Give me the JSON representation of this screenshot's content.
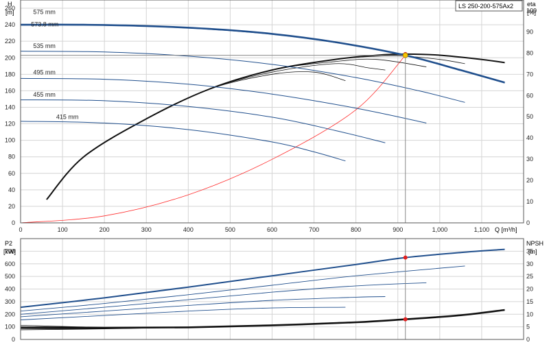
{
  "colors": {
    "frame": "#555555",
    "grid": "#d4d4d4",
    "blue_curve": "#1f4e8c",
    "black_curve": "#111111",
    "red_curve": "#ff2a2a",
    "marker_red": "#e02020",
    "marker_yellow": "#f5c400",
    "operating_line": "#888888"
  },
  "chart_data": [
    {
      "type": "line",
      "title": "LS 250-200-575Ax2",
      "xlabel": "Q [m³/h]",
      "xlim": [
        0,
        1200
      ],
      "x_ticks": [
        0,
        100,
        200,
        300,
        400,
        500,
        600,
        700,
        800,
        900,
        1000,
        1100
      ],
      "x_tick_labels": [
        "0",
        "100",
        "200",
        "300",
        "400",
        "500",
        "600",
        "700",
        "800",
        "900",
        "1,000",
        "1,100"
      ],
      "y_left": {
        "label_line1": "H",
        "label_line2": "[m]",
        "lim": [
          0,
          270
        ],
        "ticks": [
          0,
          20,
          40,
          60,
          80,
          100,
          120,
          140,
          160,
          180,
          200,
          220,
          240,
          260
        ]
      },
      "y_right": {
        "label_line1": "eta",
        "label_line2": "[%]",
        "lim": [
          0,
          105
        ],
        "ticks": [
          0,
          10,
          20,
          30,
          40,
          50,
          60,
          70,
          80,
          90,
          100
        ]
      },
      "head_curves": [
        {
          "label": "575 mm",
          "label_pos_x": 30,
          "label_pos_y": 253,
          "weight": "bold",
          "x": [
            0,
            150,
            300,
            450,
            600,
            750,
            918,
            1050,
            1155
          ],
          "y": [
            240,
            240,
            238.5,
            235,
            229,
            219,
            203,
            185,
            170
          ]
        },
        {
          "label": "573.8 mm",
          "label_pos_x": 25,
          "label_pos_y": 238,
          "weight": "thin",
          "x": [
            0,
            150,
            300,
            450,
            600,
            750,
            918,
            1050,
            1155
          ],
          "y": [
            239.5,
            239.5,
            238,
            234.5,
            228.5,
            218.5,
            202.5,
            184.5,
            169.5
          ]
        },
        {
          "label": "535 mm",
          "label_pos_x": 30,
          "label_pos_y": 212,
          "weight": "thin",
          "x": [
            0,
            200,
            400,
            600,
            800,
            950,
            1060
          ],
          "y": [
            208,
            207,
            202,
            192,
            176,
            160,
            146
          ]
        },
        {
          "label": "495 mm",
          "label_pos_x": 30,
          "label_pos_y": 180,
          "weight": "thin",
          "x": [
            0,
            200,
            400,
            600,
            800,
            968
          ],
          "y": [
            175,
            174,
            168,
            156,
            139,
            121
          ]
        },
        {
          "label": "455 mm",
          "label_pos_x": 30,
          "label_pos_y": 153,
          "weight": "thin",
          "x": [
            0,
            200,
            400,
            600,
            750,
            870
          ],
          "y": [
            149,
            148,
            141,
            128,
            112,
            97
          ]
        },
        {
          "label": "415 mm",
          "label_pos_x": 85,
          "label_pos_y": 126,
          "weight": "thin",
          "x": [
            0,
            200,
            400,
            600,
            700,
            775
          ],
          "y": [
            123,
            121,
            113,
            98,
            86,
            75
          ]
        }
      ],
      "efficiency_curves": [
        {
          "weight": "bold",
          "x": [
            62,
            150,
            300,
            450,
            600,
            750,
            850,
            918,
            1000,
            1100,
            1155
          ],
          "y": [
            11,
            31,
            49,
            63,
            72,
            77,
            79,
            79.5,
            79,
            77,
            75.5
          ]
        },
        {
          "weight": "thin",
          "x": [
            62,
            150,
            300,
            450,
            600,
            750,
            850,
            918,
            1000,
            1060
          ],
          "y": [
            11,
            31,
            49,
            63,
            72,
            77,
            78.5,
            78.5,
            77,
            75
          ]
        },
        {
          "weight": "thin",
          "x": [
            62,
            150,
            300,
            450,
            600,
            750,
            850,
            968
          ],
          "y": [
            11,
            31,
            49,
            63,
            72,
            76,
            77,
            73.5
          ]
        },
        {
          "weight": "thin",
          "x": [
            62,
            150,
            300,
            450,
            600,
            750,
            830,
            870
          ],
          "y": [
            11,
            31,
            49,
            63,
            71,
            75,
            73,
            72
          ]
        },
        {
          "weight": "thin",
          "x": [
            62,
            150,
            300,
            450,
            600,
            700,
            775
          ],
          "y": [
            11,
            31,
            49,
            63,
            70,
            71,
            67
          ]
        }
      ],
      "system_curve": {
        "x": [
          0,
          200,
          400,
          600,
          800,
          918
        ],
        "y": [
          0,
          8.5,
          34,
          77,
          137,
          203
        ]
      },
      "operating_point": {
        "q": 918,
        "head": 203,
        "eta": 79.5
      }
    },
    {
      "type": "line",
      "xlim": [
        0,
        1200
      ],
      "y_left": {
        "label_line1": "P2",
        "label_line2": "[kW]",
        "lim": [
          0,
          800
        ],
        "ticks": [
          0,
          100,
          200,
          300,
          400,
          500,
          600,
          700
        ]
      },
      "y_right": {
        "label_line1": "NPSH",
        "label_line2": "[m]",
        "lim": [
          0,
          40
        ],
        "ticks": [
          0,
          5,
          10,
          15,
          20,
          25,
          30,
          35
        ]
      },
      "power_curves": [
        {
          "weight": "bold",
          "x": [
            0,
            200,
            400,
            600,
            800,
            918,
            1050,
            1155
          ],
          "y": [
            255,
            330,
            415,
            505,
            595,
            650,
            690,
            715
          ]
        },
        {
          "weight": "thin",
          "x": [
            0,
            200,
            400,
            600,
            800,
            1060
          ],
          "y": [
            225,
            285,
            355,
            430,
            505,
            583
          ]
        },
        {
          "weight": "thin",
          "x": [
            0,
            200,
            400,
            600,
            800,
            968
          ],
          "y": [
            200,
            255,
            315,
            375,
            425,
            450
          ]
        },
        {
          "weight": "thin",
          "x": [
            0,
            200,
            400,
            600,
            800,
            870
          ],
          "y": [
            180,
            225,
            270,
            310,
            335,
            340
          ]
        },
        {
          "weight": "thin",
          "x": [
            0,
            200,
            400,
            600,
            775
          ],
          "y": [
            155,
            190,
            225,
            250,
            255
          ]
        }
      ],
      "npsh_curves": [
        {
          "weight": "bold",
          "x": [
            0,
            200,
            400,
            600,
            800,
            918,
            1050,
            1155
          ],
          "y": [
            4.8,
            4.6,
            4.8,
            5.6,
            6.8,
            8,
            9.6,
            11.7
          ]
        },
        {
          "weight": "thin",
          "x": [
            0,
            200,
            400,
            600,
            800,
            1000
          ],
          "y": [
            5.6,
            4.8,
            4.9,
            5.6,
            6.9,
            9
          ]
        },
        {
          "weight": "thin",
          "x": [
            0,
            200,
            400,
            600,
            800,
            950
          ],
          "y": [
            4.2,
            4.3,
            4.8,
            5.6,
            6.8,
            8.4
          ]
        },
        {
          "weight": "thin",
          "x": [
            0,
            200,
            400,
            600,
            800
          ],
          "y": [
            3.8,
            4.2,
            4.8,
            5.7,
            7.0
          ]
        }
      ],
      "operating_point": {
        "q": 918,
        "power": 650,
        "npsh": 8
      }
    }
  ]
}
